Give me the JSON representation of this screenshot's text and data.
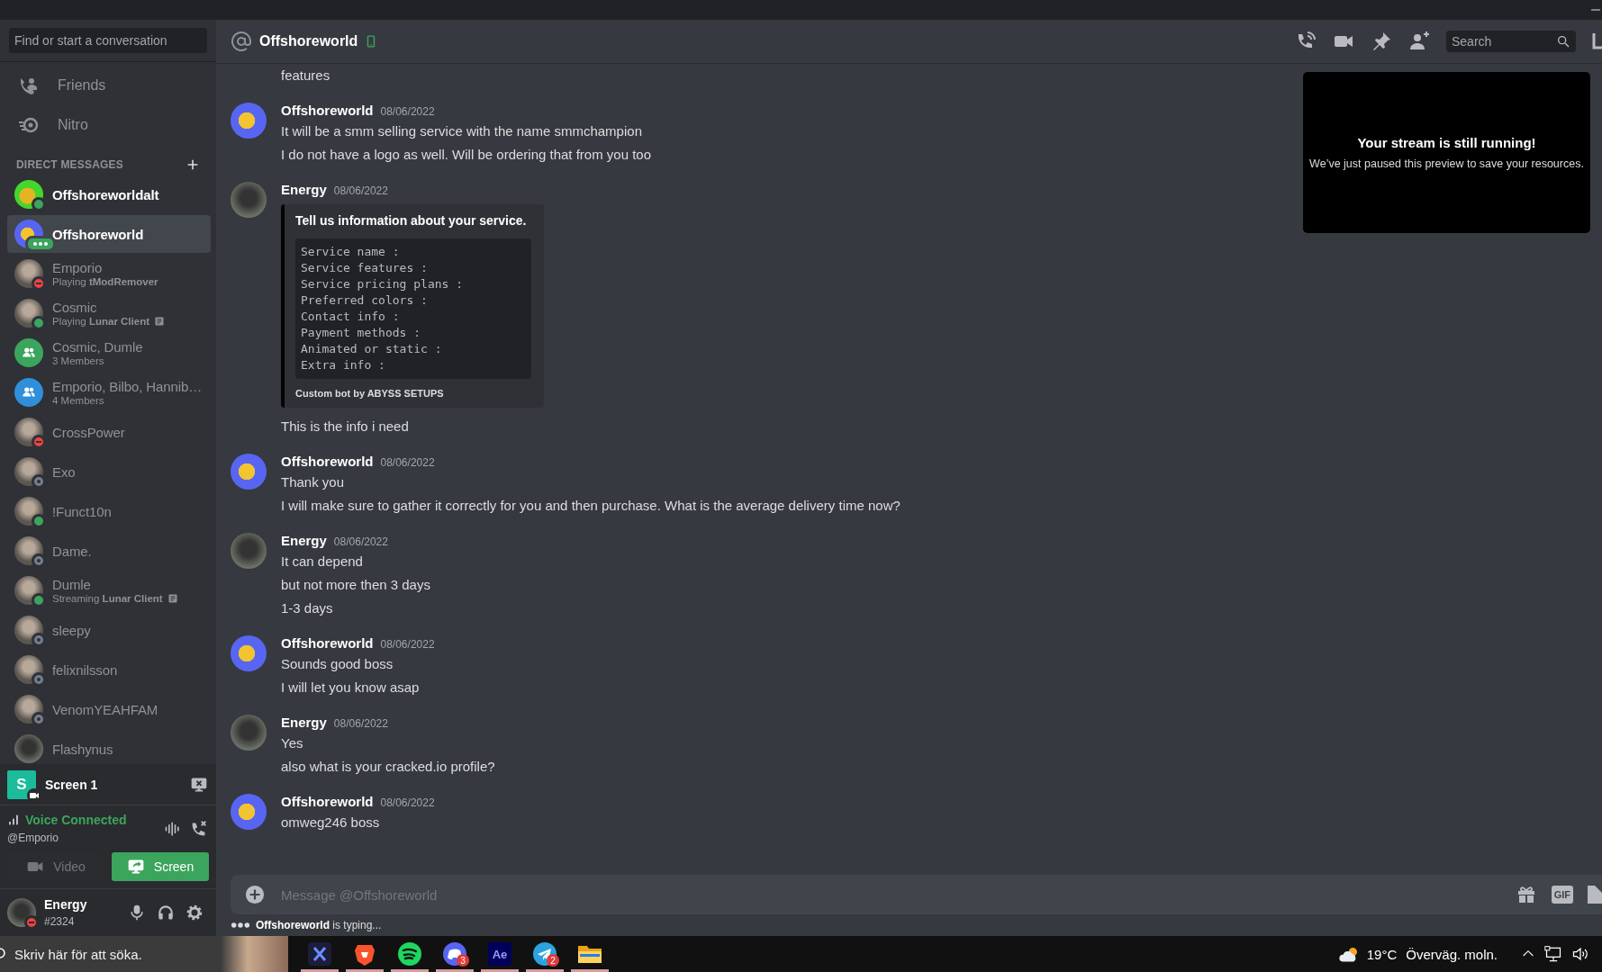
{
  "sidebar": {
    "search": {
      "placeholder": "Find or start a conversation"
    },
    "nav": [
      {
        "kind": "friends",
        "label": "Friends"
      },
      {
        "kind": "nitro",
        "label": "Nitro"
      }
    ],
    "dm_header": "DIRECT MESSAGES",
    "dms": [
      {
        "name": "Offshoreworldalt",
        "avatar": {
          "kind": "duck_green"
        },
        "presence": {
          "kind": "online",
          "color": "#3ba55d"
        },
        "unread": true,
        "selected": false
      },
      {
        "name": "Offshoreworld",
        "avatar": {
          "kind": "duck_blue"
        },
        "presence": {
          "kind": "typing",
          "color": "#3ba55d"
        },
        "unread": false,
        "selected": true
      },
      {
        "name": "Emporio",
        "avatar": {
          "kind": "photo"
        },
        "presence": {
          "kind": "dnd",
          "color": "#ed4245"
        },
        "activity": "Playing **tModRemover**",
        "unread": false,
        "selected": false
      },
      {
        "name": "Cosmic",
        "avatar": {
          "kind": "photo"
        },
        "presence": {
          "kind": "online",
          "color": "#3ba55d"
        },
        "activity": "Playing **Lunar Client**",
        "rich_presence": true,
        "unread": false,
        "selected": false
      },
      {
        "name": "Cosmic, Dumle",
        "avatar": {
          "kind": "group",
          "color": "#3ba55d"
        },
        "activity": "3 Members",
        "unread": false,
        "selected": false
      },
      {
        "name": "Emporio, Bilbo, Hannib…",
        "avatar": {
          "kind": "group",
          "color": "#2f8fdb"
        },
        "activity": "4 Members",
        "unread": false,
        "selected": false
      },
      {
        "name": "CrossPower",
        "avatar": {
          "kind": "photo"
        },
        "presence": {
          "kind": "dnd",
          "color": "#ed4245"
        },
        "unread": false,
        "selected": false
      },
      {
        "name": "Exo",
        "avatar": {
          "kind": "photo"
        },
        "presence": {
          "kind": "offline",
          "color": "#747f8d"
        },
        "unread": false,
        "selected": false
      },
      {
        "name": "!Funct10n",
        "avatar": {
          "kind": "photo"
        },
        "presence": {
          "kind": "online",
          "color": "#3ba55d"
        },
        "unread": false,
        "selected": false
      },
      {
        "name": "Dame.",
        "avatar": {
          "kind": "photo"
        },
        "presence": {
          "kind": "offline",
          "color": "#747f8d"
        },
        "unread": false,
        "selected": false
      },
      {
        "name": "Dumle",
        "avatar": {
          "kind": "photo"
        },
        "presence": {
          "kind": "online",
          "color": "#3ba55d"
        },
        "activity": "Streaming **Lunar Client**",
        "rich_presence": true,
        "unread": false,
        "selected": false
      },
      {
        "name": "sleepy",
        "avatar": {
          "kind": "photo"
        },
        "presence": {
          "kind": "offline",
          "color": "#747f8d"
        },
        "unread": false,
        "selected": false
      },
      {
        "name": "felixnilsson",
        "avatar": {
          "kind": "photo"
        },
        "presence": {
          "kind": "offline",
          "color": "#747f8d"
        },
        "unread": false,
        "selected": false
      },
      {
        "name": "VenomYEAHFAM",
        "avatar": {
          "kind": "photo"
        },
        "presence": {
          "kind": "offline",
          "color": "#747f8d"
        },
        "unread": false,
        "selected": false
      },
      {
        "name": "Flashynus",
        "avatar": {
          "kind": "photo_dark"
        },
        "unread": false,
        "selected": false
      }
    ],
    "stream": {
      "tile": "S",
      "title": "Screen 1"
    },
    "voice": {
      "status": "Voice Connected",
      "channel": "@Emporio",
      "buttons": [
        {
          "kind": "video",
          "label": "Video",
          "on": false
        },
        {
          "kind": "screen",
          "label": "Screen",
          "on": true
        }
      ]
    },
    "user": {
      "name": "Energy",
      "tag": "#2324",
      "presence": {
        "kind": "dnd",
        "color": "#ed4245"
      }
    }
  },
  "header": {
    "name": "Offshoreworld",
    "on_mobile": true,
    "search_placeholder": "Search"
  },
  "messages": [
    {
      "lines": [
        {
          "kind": "text",
          "text": "features"
        }
      ]
    },
    {
      "author": "Offshoreworld",
      "avatar": {
        "kind": "duck_blue"
      },
      "timestamp": "08/06/2022",
      "lines": [
        {
          "kind": "text",
          "text": "It will be a smm selling service with the name smmchampion"
        },
        {
          "kind": "text",
          "text": "I do not have a logo as well. Will be ordering that from you too"
        }
      ]
    },
    {
      "author": "Energy",
      "avatar": {
        "kind": "photo_dark"
      },
      "timestamp": "08/06/2022",
      "lines": [
        {
          "kind": "embed",
          "title": "Tell us information about your service.",
          "code": [
            "Service name :",
            "Service features :",
            "Service pricing plans :",
            "Preferred colors :",
            "Contact info :",
            "Payment methods :",
            "Animated or static :",
            "Extra info :"
          ],
          "footer": "Custom bot by ABYSS SETUPS"
        },
        {
          "kind": "text",
          "text": "This is the info i need"
        }
      ]
    },
    {
      "author": "Offshoreworld",
      "avatar": {
        "kind": "duck_blue"
      },
      "timestamp": "08/06/2022",
      "lines": [
        {
          "kind": "text",
          "text": "Thank you"
        },
        {
          "kind": "text",
          "text": "I will make sure to gather it correctly for you and then purchase. What is the average delivery time now?"
        }
      ]
    },
    {
      "author": "Energy",
      "avatar": {
        "kind": "photo_dark"
      },
      "timestamp": "08/06/2022",
      "lines": [
        {
          "kind": "text",
          "text": "It can depend"
        },
        {
          "kind": "text",
          "text": "but not more then 3 days"
        },
        {
          "kind": "text",
          "text": "1-3 days"
        }
      ]
    },
    {
      "author": "Offshoreworld",
      "avatar": {
        "kind": "duck_blue"
      },
      "timestamp": "08/06/2022",
      "lines": [
        {
          "kind": "text",
          "text": "Sounds good boss"
        },
        {
          "kind": "text",
          "text": "I will let you know asap"
        }
      ]
    },
    {
      "author": "Energy",
      "avatar": {
        "kind": "photo_dark"
      },
      "timestamp": "08/06/2022",
      "lines": [
        {
          "kind": "text",
          "text": "Yes"
        },
        {
          "kind": "text",
          "text": "also what is your cracked.io profile?"
        }
      ]
    },
    {
      "author": "Offshoreworld",
      "avatar": {
        "kind": "duck_blue"
      },
      "timestamp": "08/06/2022",
      "lines": [
        {
          "kind": "text",
          "text": "omweg246 boss"
        }
      ]
    }
  ],
  "stream_preview": {
    "title": "Your stream is still running!",
    "text": "We’ve just paused this preview to save your resources."
  },
  "composer": {
    "placeholder": "Message @Offshoreworld",
    "gif": "GIF"
  },
  "typing": "**Offshoreworld** is typing...",
  "taskbar": {
    "search_placeholder": "Skriv här för att söka.",
    "apps": [
      {
        "kind": "exodus",
        "running": true
      },
      {
        "kind": "brave",
        "running": true
      },
      {
        "kind": "spotify",
        "running": true
      },
      {
        "kind": "discord",
        "badge": "3",
        "running": true
      },
      {
        "kind": "aftereffects",
        "label": "Ae",
        "running": true
      },
      {
        "kind": "telegram",
        "badge": "2",
        "running": true
      },
      {
        "kind": "explorer",
        "running": true
      }
    ],
    "weather": {
      "temp": "19°C",
      "text": "Överväg. moln."
    }
  }
}
